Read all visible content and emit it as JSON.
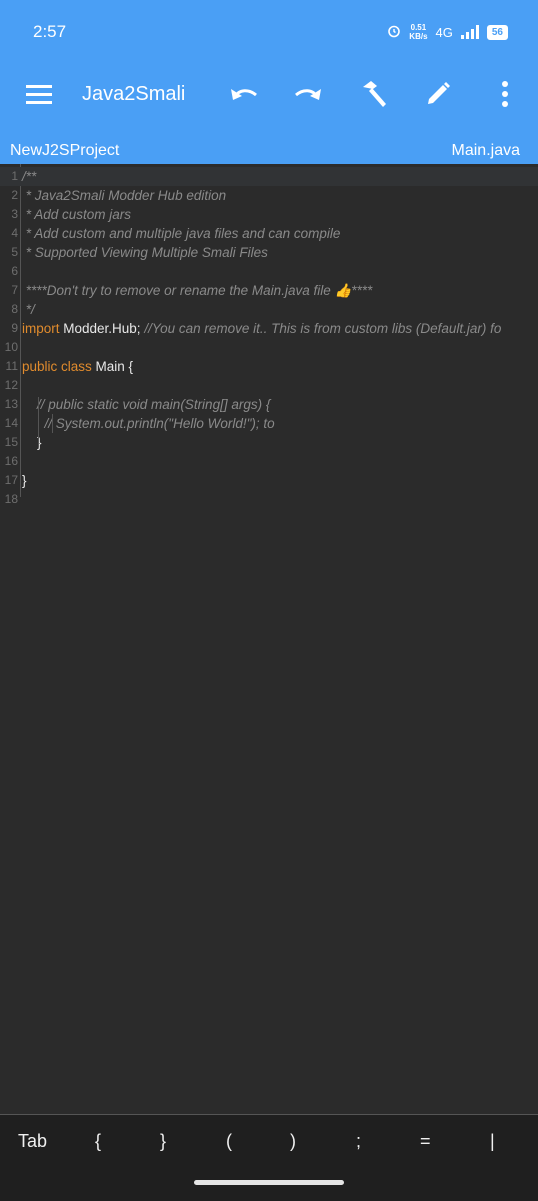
{
  "status": {
    "time": "2:57",
    "net_speed_value": "0.51",
    "net_speed_unit": "KB/s",
    "network": "4G",
    "battery": "56"
  },
  "toolbar": {
    "title": "Java2Smali",
    "icons": [
      "menu-icon",
      "undo-icon",
      "redo-icon",
      "hammer-icon",
      "pencil-icon",
      "more-vert-icon"
    ]
  },
  "filebar": {
    "project": "NewJ2SProject",
    "file": "Main.java"
  },
  "editor": {
    "lines": [
      {
        "n": "1",
        "t": "/**"
      },
      {
        "n": "2",
        "t": " * Java2Smali Modder Hub edition"
      },
      {
        "n": "3",
        "t": " * Add custom jars"
      },
      {
        "n": "4",
        "t": " * Add custom and multiple java files and can compile"
      },
      {
        "n": "5",
        "t": " * Supported Viewing Multiple Smali Files"
      },
      {
        "n": "6",
        "t": ""
      },
      {
        "n": "7",
        "t": " ****Don't try to remove or rename the Main.java file 👍****"
      },
      {
        "n": "8",
        "t": " */"
      },
      {
        "n": "9",
        "kw": "import",
        "t": " Modder.Hub;",
        "c": " //You can remove it.. This is from custom libs (Default.jar) fo"
      },
      {
        "n": "10",
        "t": ""
      },
      {
        "n": "11",
        "kw": "public class",
        "t": " Main {"
      },
      {
        "n": "12",
        "t": ""
      },
      {
        "n": "13",
        "t": "    // public static void main(String[] args) {"
      },
      {
        "n": "14",
        "t": "      // System.out.println(\"Hello World!\"); to"
      },
      {
        "n": "15",
        "t": "    }"
      },
      {
        "n": "16",
        "t": ""
      },
      {
        "n": "17",
        "t": "}"
      },
      {
        "n": "18",
        "t": ""
      }
    ]
  },
  "keys": [
    "Tab",
    "{",
    "}",
    "(",
    ")",
    ";",
    "=",
    "|"
  ]
}
